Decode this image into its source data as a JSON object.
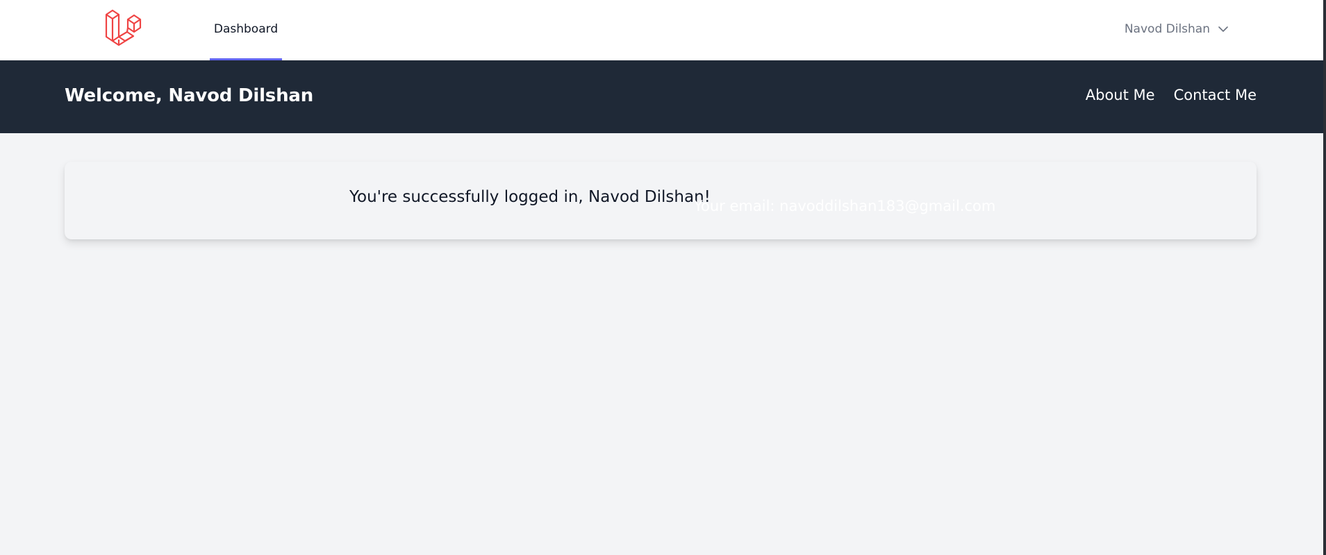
{
  "nav": {
    "logo_icon": "laravel-logo-icon",
    "tab_dashboard": "Dashboard",
    "user_name": "Navod Dilshan",
    "user_menu_icon": "chevron-down-icon"
  },
  "header": {
    "welcome": "Welcome, Navod Dilshan",
    "links": {
      "about": "About Me",
      "contact": "Contact Me"
    }
  },
  "card": {
    "message": "You're successfully logged in, Navod Dilshan!",
    "email_line": "Your email: navoddilshan183@gmail.com"
  },
  "colors": {
    "accent": "#6366f1",
    "brand_logo": "#ef4444",
    "header_bg": "#1f2937",
    "page_bg": "#f3f4f6"
  }
}
